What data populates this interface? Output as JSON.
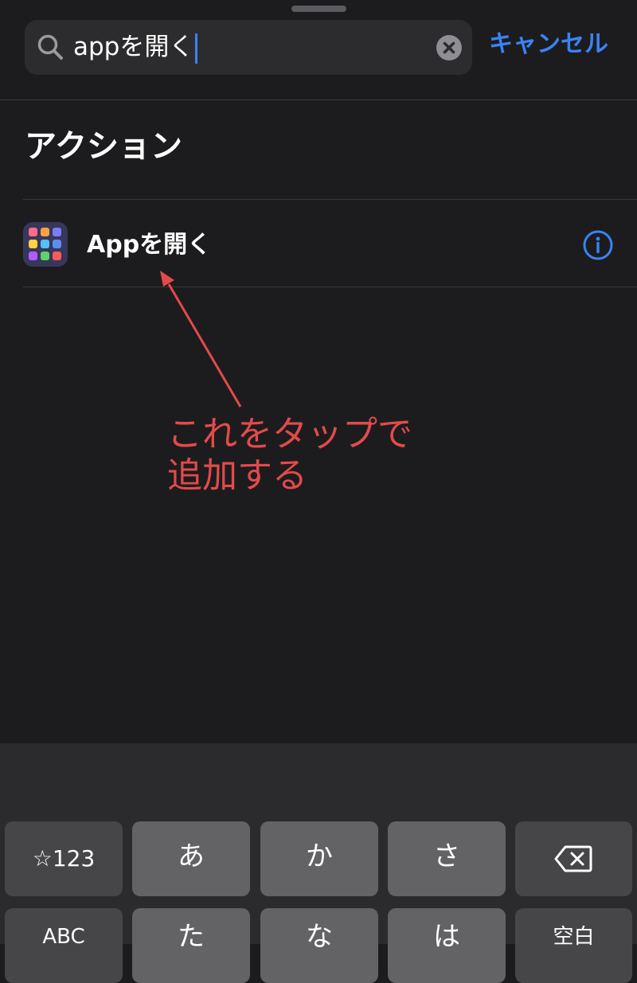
{
  "search": {
    "query": "appを開く",
    "cancel_label": "キャンセル"
  },
  "section": {
    "title": "アクション"
  },
  "action_item": {
    "label": "Appを開く",
    "icon": "apps-grid-icon",
    "info_icon": "info-icon"
  },
  "annotation": {
    "line1": "これをタップで",
    "line2": "追加する",
    "color": "#e34a4a"
  },
  "keyboard": {
    "row1": [
      "☆123",
      "あ",
      "か",
      "さ"
    ],
    "delete_icon": "delete-backward-icon",
    "row2": [
      "ABC",
      "た",
      "な",
      "は",
      "空白"
    ]
  },
  "colors": {
    "accent": "#3b82f6",
    "background": "#1c1c1e"
  }
}
